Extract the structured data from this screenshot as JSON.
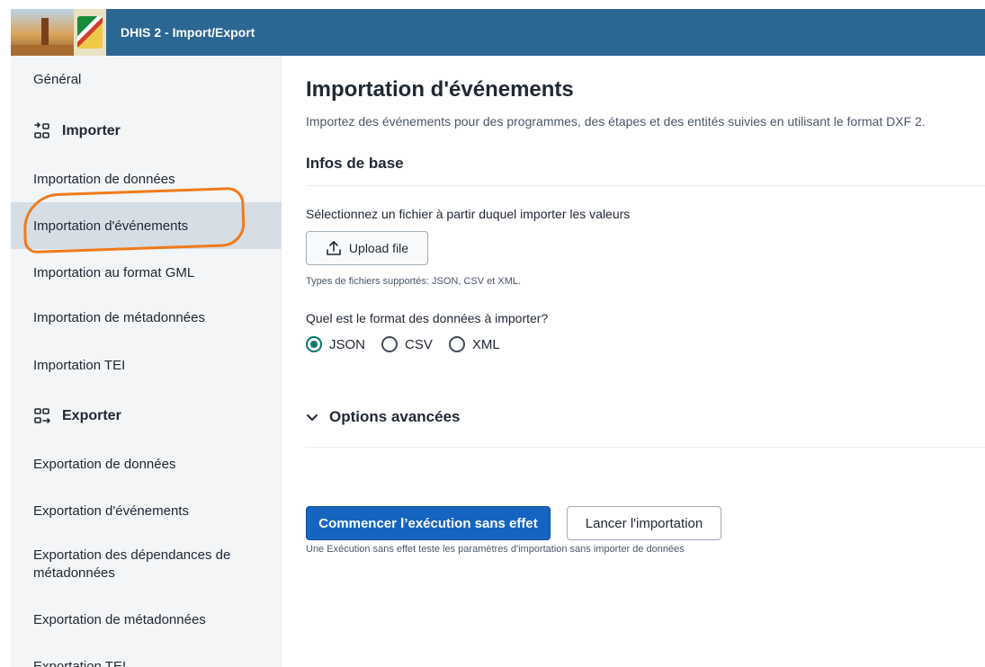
{
  "header": {
    "title": "DHIS 2 - Import/Export"
  },
  "sidebar": {
    "general": "Général",
    "import_section": {
      "label": "Importer",
      "icon": "import-icon"
    },
    "import_items": [
      "Importation de données",
      "Importation d'événements",
      "Importation au format GML",
      "Importation de métadonnées",
      "Importation TEI"
    ],
    "export_section": {
      "label": "Exporter",
      "icon": "export-icon"
    },
    "export_items": [
      "Exportation de données",
      "Exportation d'événements",
      "Exportation des dépendances de métadonnées",
      "Exportation de métadonnées",
      "Exportation TEI"
    ],
    "active_item": "Importation d'événements"
  },
  "main": {
    "title": "Importation d'événements",
    "description": "Importez des événements pour des programmes, des étapes et des entités suivies en utilisant le format DXF 2.",
    "section_title": "Infos de base",
    "file_label": "Sélectionnez un fichier à partir duquel importer les valeurs",
    "upload_button": "Upload file",
    "file_types": "Types de fichiers supportés: JSON, CSV et XML.",
    "format_label": "Quel est le format des données à importer?",
    "format_options": [
      "JSON",
      "CSV",
      "XML"
    ],
    "format_selected": "JSON",
    "advanced_options": "Options avancées",
    "dry_run_button": "Commencer l’exécution sans effet",
    "import_button": "Lancer l'importation",
    "dry_run_help": "Une Exécution sans effet teste les paramètres d'importation sans importer de données"
  },
  "colors": {
    "header_bg": "#2c6693",
    "primary": "#1565c0",
    "radio_checked": "#00796b",
    "annotation": "#f07a1a",
    "sidebar_active": "#d5dde5"
  }
}
